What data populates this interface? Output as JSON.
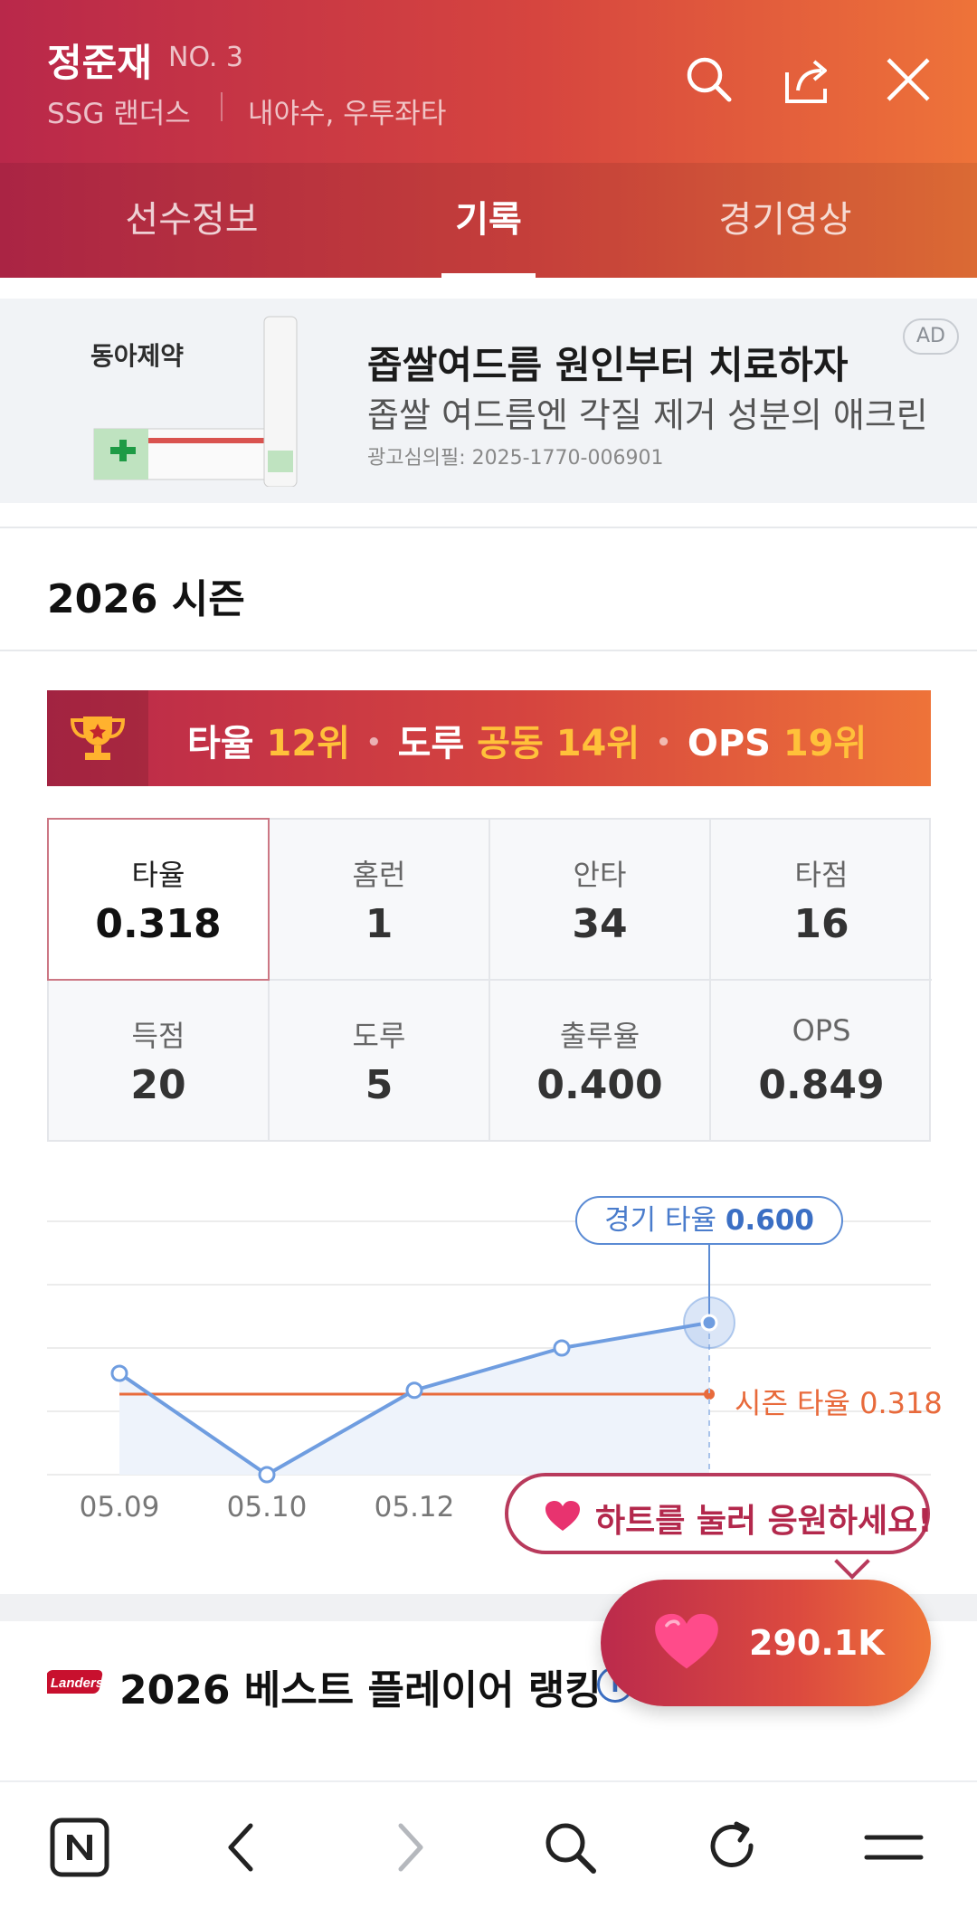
{
  "header": {
    "player_name": "정준재",
    "player_no": "NO. 3",
    "team": "SSG 랜더스",
    "position": "내야수, 우투좌타",
    "icons": [
      "search-icon",
      "share-icon",
      "close-icon"
    ],
    "colors": {
      "gradient_start": "#b9284a",
      "gradient_end": "#ee7339"
    }
  },
  "tabs": [
    {
      "label": "선수정보",
      "active": false
    },
    {
      "label": "기록",
      "active": true
    },
    {
      "label": "경기영상",
      "active": false
    }
  ],
  "ad": {
    "brand": "동아제약",
    "product": "애크린",
    "title": "좁쌀여드름 원인부터 치료하자",
    "subtitle": "좁쌀 여드름엔 각질 제거 성분의 애크린",
    "cert": "광고심의필: 2025-1770-006901",
    "badge": "AD"
  },
  "season": {
    "title": "2026 시즌",
    "rank": {
      "avg_label": "타율",
      "avg_rank": "12위",
      "sb_label": "도루",
      "sb_rank": "공동 14위",
      "ops_label": "OPS",
      "ops_rank": "19위"
    },
    "stats": [
      {
        "label": "타율",
        "value": "0.318",
        "active": true
      },
      {
        "label": "홈런",
        "value": "1"
      },
      {
        "label": "안타",
        "value": "34"
      },
      {
        "label": "타점",
        "value": "16"
      },
      {
        "label": "득점",
        "value": "20"
      },
      {
        "label": "도루",
        "value": "5"
      },
      {
        "label": "출루율",
        "value": "0.400"
      },
      {
        "label": "OPS",
        "value": "0.849"
      }
    ]
  },
  "chart_data": {
    "type": "line",
    "x": [
      "05.09",
      "05.10",
      "05.12",
      "",
      ""
    ],
    "series": [
      {
        "values": [
          0.4,
          0.0,
          0.333,
          0.5,
          0.6
        ]
      }
    ],
    "reference_line": {
      "label": "시즌 타율 0.318",
      "value": 0.318
    },
    "tooltip": {
      "label": "경기 타율",
      "value": "0.600"
    },
    "ylim": [
      0,
      1.0
    ],
    "grid": true,
    "colors": {
      "line": "#6f9de0",
      "reference": "#e86a3b",
      "fill": "#eef3fb"
    }
  },
  "cheer": {
    "text": "하트를 눌러 응원하세요!",
    "count": "290.1K"
  },
  "best": {
    "title": "2026 베스트 플레이어 랭킹",
    "info_icon": "i"
  },
  "bottom_nav": [
    "naver-icon",
    "back-icon",
    "forward-icon",
    "search-icon",
    "refresh-icon",
    "menu-icon"
  ]
}
